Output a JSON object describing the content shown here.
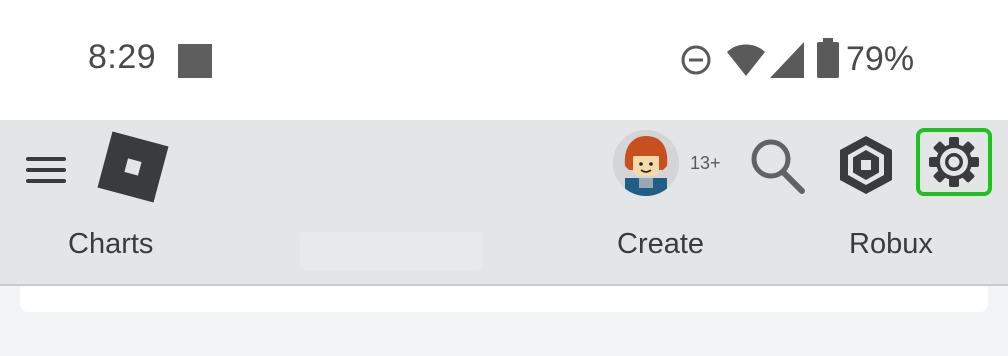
{
  "status_bar": {
    "time": "8:29",
    "battery_percent": "79%",
    "icons": [
      "notification-square-icon",
      "do-not-disturb-icon",
      "wifi-icon",
      "cell-signal-icon",
      "battery-icon"
    ]
  },
  "header": {
    "icons": [
      "menu-icon",
      "roblox-logo",
      "avatar",
      "search-icon",
      "robux-icon",
      "settings-icon"
    ],
    "age_badge": "13+",
    "highlight_color": "#1ec21e"
  },
  "nav": {
    "items": [
      {
        "label": "Charts"
      },
      {
        "label": "Create"
      },
      {
        "label": "Robux"
      }
    ]
  },
  "colors": {
    "header_bg": "#e3e5e6",
    "content_bg": "#f2f4f5"
  }
}
